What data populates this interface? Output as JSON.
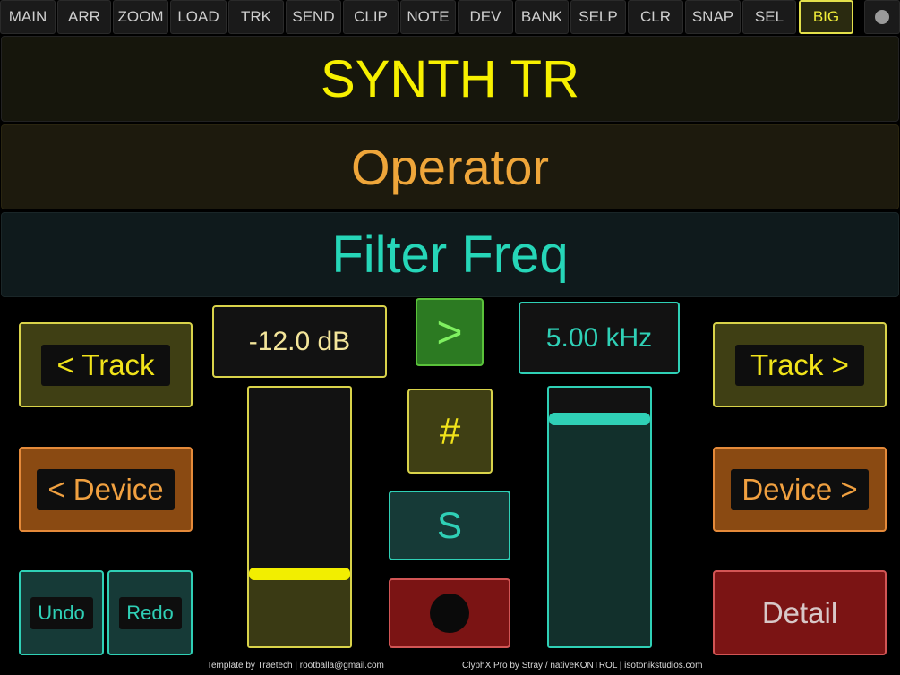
{
  "tabs": [
    "MAIN",
    "ARR",
    "ZOOM",
    "LOAD",
    "TRK",
    "SEND",
    "CLIP",
    "NOTE",
    "DEV",
    "BANK",
    "SELP",
    "CLR",
    "SNAP",
    "SEL",
    "BIG"
  ],
  "active_tab": "BIG",
  "banner": {
    "track": "SYNTH TR",
    "device": "Operator",
    "parameter": "Filter Freq"
  },
  "left": {
    "prev_track": "< Track",
    "prev_device": "< Device",
    "undo": "Undo",
    "redo": "Redo"
  },
  "right": {
    "next_track": "Track >",
    "next_device": "Device >",
    "detail": "Detail"
  },
  "volume": {
    "readout": "-12.0 dB",
    "level": 0.28
  },
  "param": {
    "readout": "5.00 kHz",
    "level": 0.88
  },
  "center": {
    "arrow": ">",
    "hash": "#",
    "solo": "S"
  },
  "footer": {
    "template": "Template by Traetech | rootballa@gmail.com",
    "credits": "ClyphX Pro by Stray / nativeKONTROL |  isotonikstudios.com"
  },
  "colors": {
    "yellow": "#f1e31a",
    "orange": "#f0a040",
    "teal": "#2fd0b6",
    "red": "#7b1414"
  }
}
